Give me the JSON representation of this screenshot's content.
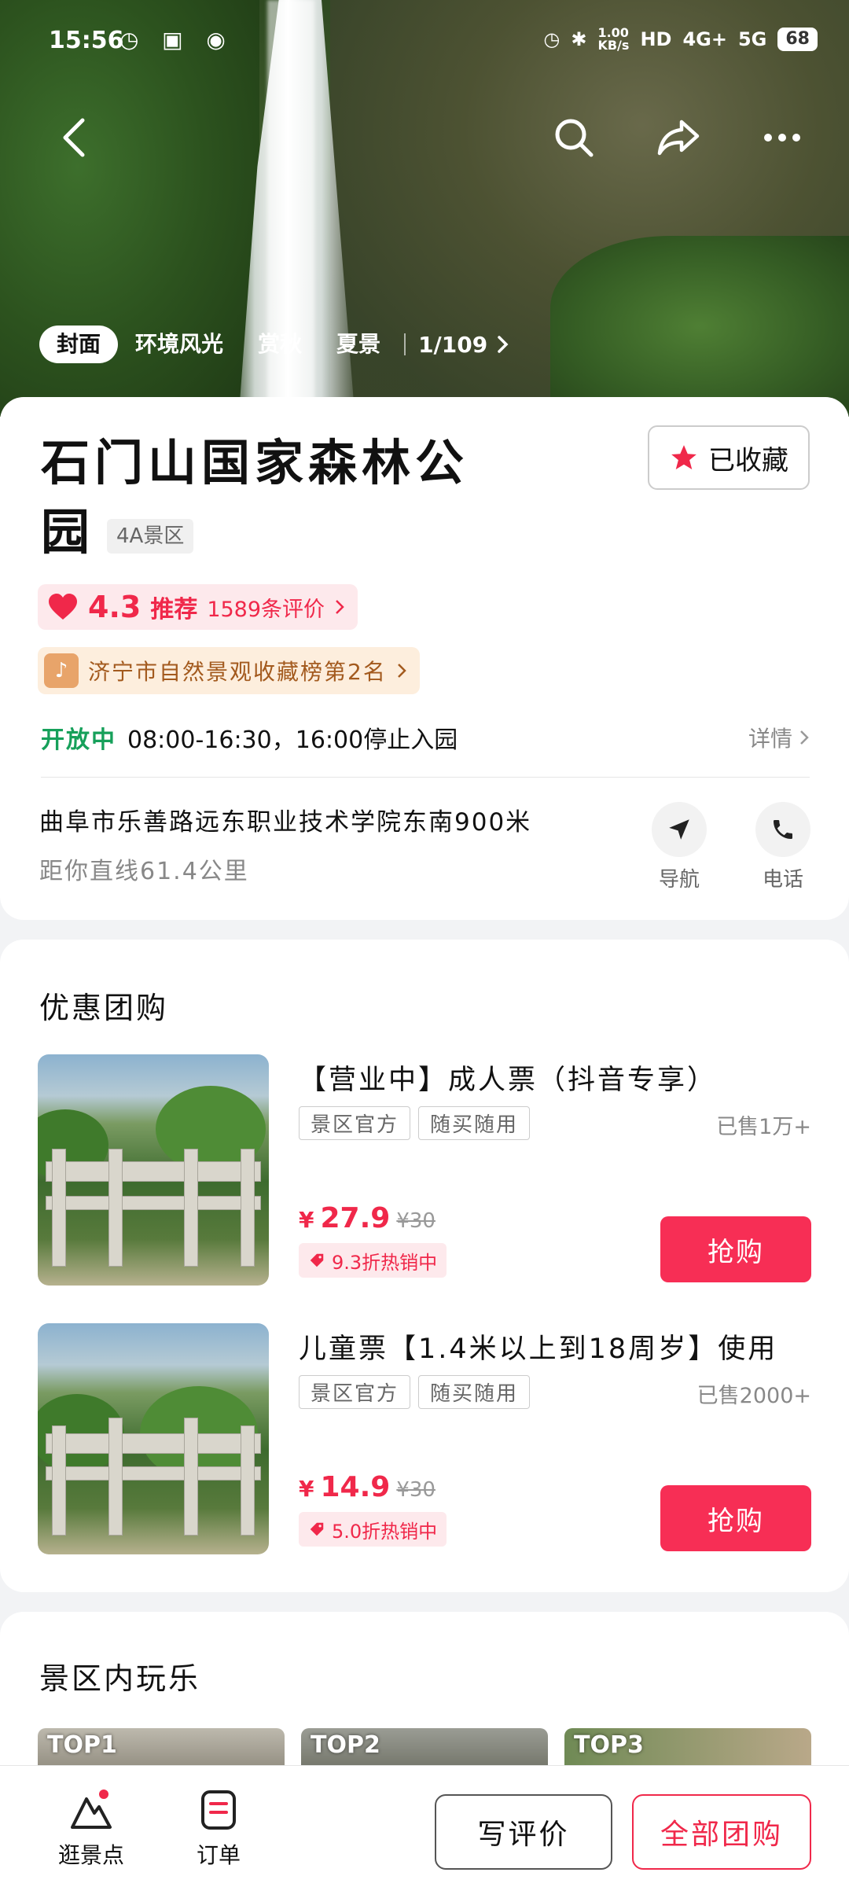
{
  "status_bar": {
    "time": "15:56",
    "net_speed": "1.00 KB/s",
    "hd": "HD",
    "net1": "4G+",
    "net2": "5G",
    "battery": "68"
  },
  "gallery": {
    "tabs": [
      {
        "label": "封面",
        "active": true
      },
      {
        "label": "环境风光",
        "active": false
      },
      {
        "label": "赏秋",
        "active": false
      },
      {
        "label": "夏景",
        "active": false
      }
    ],
    "count": "1/109"
  },
  "poi": {
    "title_line1": "石门山国家森林公",
    "title_line2": "园",
    "level_badge": "4A景区",
    "favorite_label": "已收藏",
    "rating": "4.3",
    "recommend_label": "推荐",
    "reviews": "1589条评价",
    "rank_text": "济宁市自然景观收藏榜第2名",
    "open_status": "开放中",
    "hours": "08:00-16:30，16:00停止入园",
    "detail_label": "详情",
    "address": "曲阜市乐善路远东职业技术学院东南900米",
    "distance": "距你直线61.4公里",
    "nav_label": "导航",
    "phone_label": "电话"
  },
  "deals": {
    "section_title": "优惠团购",
    "items": [
      {
        "name": "【营业中】成人票（抖音专享）",
        "tags": [
          "景区官方",
          "随买随用"
        ],
        "sold": "已售1万+",
        "currency": "¥",
        "price": "27.9",
        "original": "¥30",
        "discount": "9.3折热销中",
        "buy_label": "抢购"
      },
      {
        "name": "儿童票【1.4米以上到18周岁】使用",
        "tags": [
          "景区官方",
          "随买随用"
        ],
        "sold": "已售2000+",
        "currency": "¥",
        "price": "14.9",
        "original": "¥30",
        "discount": "5.0折热销中",
        "buy_label": "抢购"
      }
    ]
  },
  "play": {
    "section_title": "景区内玩乐",
    "tops": [
      "TOP1",
      "TOP2",
      "TOP3"
    ]
  },
  "bottom_bar": {
    "explore_label": "逛景点",
    "orders_label": "订单",
    "review_label": "写评价",
    "all_deals_label": "全部团购"
  },
  "colors": {
    "brand_red": "#f0284a",
    "open_green": "#16a05a",
    "buy_button": "#f72e55"
  }
}
